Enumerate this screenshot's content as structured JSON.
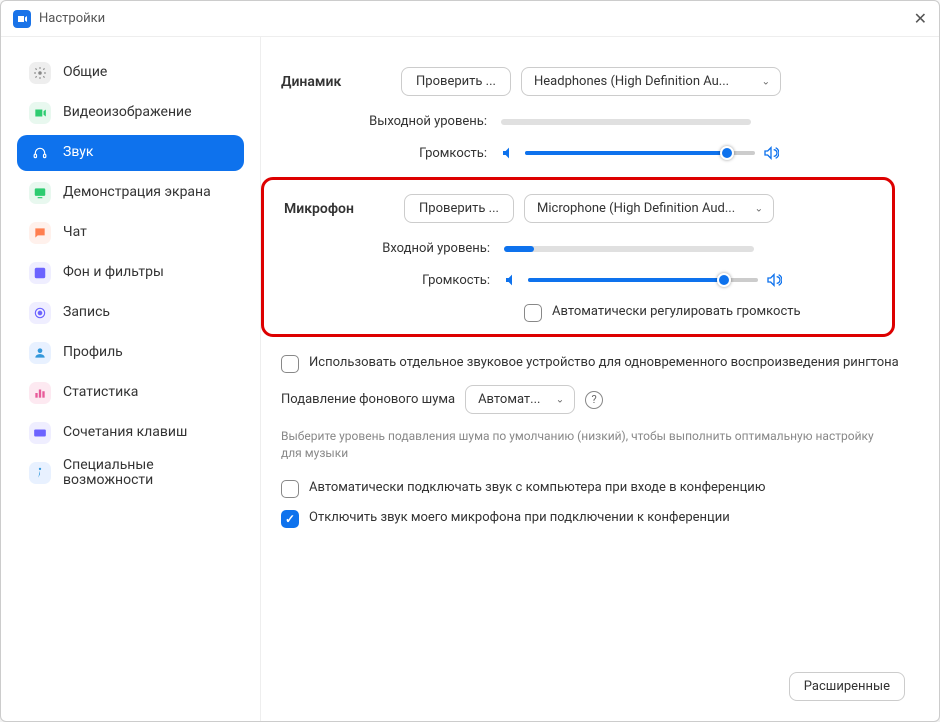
{
  "window": {
    "title": "Настройки"
  },
  "sidebar": {
    "items": [
      {
        "label": "Общие",
        "icon": "gear",
        "color": "#b0b0b0"
      },
      {
        "label": "Видеоизображение",
        "icon": "video",
        "color": "#2ecc71"
      },
      {
        "label": "Звук",
        "icon": "headphones",
        "color": "#ffffff",
        "active": true
      },
      {
        "label": "Демонстрация экрана",
        "icon": "screen",
        "color": "#2ecc71"
      },
      {
        "label": "Чат",
        "icon": "chat",
        "color": "#ff7f50"
      },
      {
        "label": "Фон и фильтры",
        "icon": "bg",
        "color": "#6c63ff"
      },
      {
        "label": "Запись",
        "icon": "record",
        "color": "#6c63ff"
      },
      {
        "label": "Профиль",
        "icon": "profile",
        "color": "#3498db"
      },
      {
        "label": "Статистика",
        "icon": "stats",
        "color": "#e85a9a"
      },
      {
        "label": "Сочетания клавиш",
        "icon": "keyboard",
        "color": "#6c63ff"
      },
      {
        "label": "Специальные возможности",
        "icon": "a11y",
        "color": "#3498db"
      }
    ]
  },
  "speaker": {
    "title": "Динамик",
    "test_btn": "Проверить ...",
    "device": "Headphones (High Definition Au...",
    "output_level_label": "Выходной уровень:",
    "output_level": 0,
    "volume_label": "Громкость:",
    "volume": 88
  },
  "mic": {
    "title": "Микрофон",
    "test_btn": "Проверить ...",
    "device": "Microphone (High Definition Aud...",
    "input_level_label": "Входной уровень:",
    "input_level": 12,
    "volume_label": "Громкость:",
    "volume": 85,
    "auto_adjust": "Автоматически регулировать громкость"
  },
  "options": {
    "separate_ringtone": "Использовать отдельное звуковое устройство для одновременного воспроизведения рингтона",
    "noise_label": "Подавление фонового шума",
    "noise_value": "Автомат...",
    "noise_hint": "Выберите уровень подавления шума по умолчанию (низкий), чтобы выполнить оптимальную настройку для музыки",
    "auto_join_audio": "Автоматически подключать звук с компьютера при входе в конференцию",
    "mute_on_join": "Отключить звук моего микрофона при подключении к конференции"
  },
  "footer": {
    "advanced": "Расширенные"
  }
}
